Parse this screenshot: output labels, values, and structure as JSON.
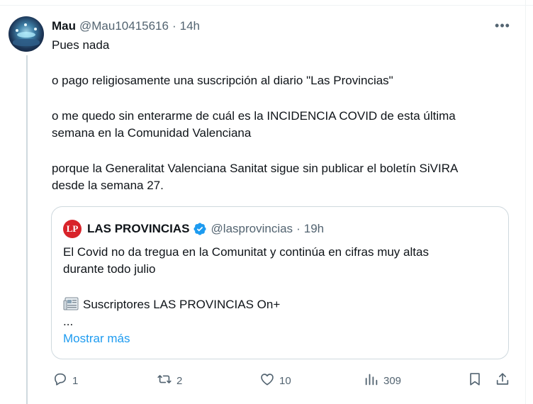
{
  "tweet": {
    "author_name": "Mau",
    "author_handle": "@Mau10415616",
    "separator": "·",
    "time": "14h",
    "more_label": "•••",
    "text": {
      "p1": "Pues nada",
      "p2": "o pago religiosamente una suscripción al diario \"Las Provincias\"",
      "p3a": "o me quedo sin enterarme de cuál es la INCIDENCIA COVID de esta última",
      "p3b": "semana en la Comunidad Valenciana",
      "p4a": "porque la Generalitat Valenciana Sanitat sigue sin publicar el boletín SiVIRA",
      "p4b": "desde la semana 27."
    }
  },
  "quote": {
    "logo_text": "LP",
    "author_name": "LAS PROVINCIAS",
    "author_handle": "@lasprovincias",
    "separator": "·",
    "time": "19h",
    "line1": "El Covid no da tregua en la Comunitat y continúa en cifras muy altas",
    "line2": "durante todo julio",
    "line3": "Suscriptores LAS PROVINCIAS On+",
    "line4": "...",
    "show_more": "Mostrar más"
  },
  "actions": {
    "replies": "1",
    "retweets": "2",
    "likes": "10",
    "views": "309"
  },
  "colors": {
    "accent": "#1d9bf0",
    "muted": "#536471",
    "verified": "#1d9bf0",
    "lp_red": "#d8232a"
  },
  "icons": [
    "reply-icon",
    "retweet-icon",
    "like-icon",
    "views-icon",
    "bookmark-icon",
    "share-icon",
    "verified-badge-icon",
    "newspaper-icon",
    "more-icon"
  ]
}
